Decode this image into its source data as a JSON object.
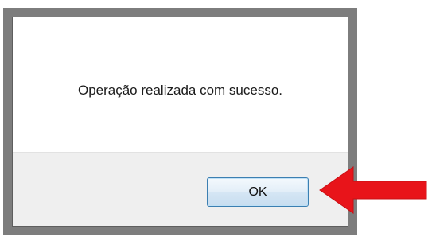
{
  "dialog": {
    "message": "Operação realizada com sucesso.",
    "ok_label": "OK"
  },
  "colors": {
    "frame": "#7d7d7d",
    "footer": "#efefef",
    "button_border": "#3c7fb1",
    "arrow": "#e8141a"
  },
  "icons": {
    "pointer": "red-arrow-icon"
  }
}
